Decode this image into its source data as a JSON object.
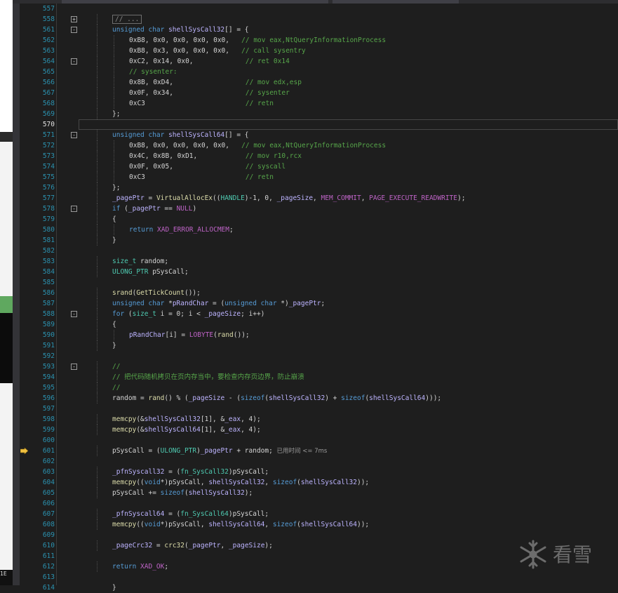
{
  "editor": {
    "first_line": 557,
    "current_line": 570,
    "breakpoint_line": 601,
    "lines": [
      {
        "n": 557,
        "indent": 0,
        "segs": []
      },
      {
        "n": 558,
        "fold": "+",
        "indent": 1,
        "collapsed": "// ..."
      },
      {
        "n": 561,
        "fold": "-",
        "indent": 1,
        "segs": [
          [
            "k",
            "unsigned char "
          ],
          [
            "v",
            "shellSysCall32"
          ],
          [
            "p",
            "[] = {"
          ]
        ]
      },
      {
        "n": 562,
        "indent": 2,
        "segs": [
          [
            "p",
            "0xB8, 0x0, 0x0, 0x0, 0x0,   "
          ],
          [
            "c",
            "// mov eax,NtQueryInformationProcess"
          ]
        ]
      },
      {
        "n": 563,
        "indent": 2,
        "segs": [
          [
            "p",
            "0xB8, 0x3, 0x0, 0x0, 0x0,   "
          ],
          [
            "c",
            "// call sysentry"
          ]
        ]
      },
      {
        "n": 564,
        "fold": "-",
        "indent": 2,
        "segs": [
          [
            "p",
            "0xC2, 0x14, 0x0,             "
          ],
          [
            "c",
            "// ret 0x14"
          ]
        ]
      },
      {
        "n": 565,
        "indent": 2,
        "segs": [
          [
            "c",
            "// sysenter:"
          ]
        ]
      },
      {
        "n": 566,
        "indent": 2,
        "segs": [
          [
            "p",
            "0x8B, 0xD4,                  "
          ],
          [
            "c",
            "// mov edx,esp"
          ]
        ]
      },
      {
        "n": 567,
        "indent": 2,
        "segs": [
          [
            "p",
            "0x0F, 0x34,                  "
          ],
          [
            "c",
            "// sysenter"
          ]
        ]
      },
      {
        "n": 568,
        "indent": 2,
        "segs": [
          [
            "p",
            "0xC3                         "
          ],
          [
            "c",
            "// retn"
          ]
        ]
      },
      {
        "n": 569,
        "indent": 1,
        "segs": [
          [
            "p",
            "};"
          ]
        ]
      },
      {
        "n": 570,
        "indent": 0,
        "segs": [],
        "current": true
      },
      {
        "n": 571,
        "fold": "-",
        "indent": 1,
        "segs": [
          [
            "k",
            "unsigned char "
          ],
          [
            "v",
            "shellSysCall64"
          ],
          [
            "p",
            "[] = {"
          ]
        ]
      },
      {
        "n": 572,
        "indent": 2,
        "segs": [
          [
            "p",
            "0xB8, 0x0, 0x0, 0x0, 0x0,   "
          ],
          [
            "c",
            "// mov eax,NtQueryInformationProcess"
          ]
        ]
      },
      {
        "n": 573,
        "indent": 2,
        "segs": [
          [
            "p",
            "0x4C, 0x8B, 0xD1,            "
          ],
          [
            "c",
            "// mov r10,rcx"
          ]
        ]
      },
      {
        "n": 574,
        "indent": 2,
        "segs": [
          [
            "p",
            "0x0F, 0x05,                  "
          ],
          [
            "c",
            "// syscall"
          ]
        ]
      },
      {
        "n": 575,
        "indent": 2,
        "segs": [
          [
            "p",
            "0xC3                         "
          ],
          [
            "c",
            "// retn"
          ]
        ]
      },
      {
        "n": 576,
        "indent": 1,
        "segs": [
          [
            "p",
            "};"
          ]
        ]
      },
      {
        "n": 577,
        "indent": 1,
        "segs": [
          [
            "v",
            "_pagePtr"
          ],
          [
            "p",
            " = "
          ],
          [
            "f",
            "VirtualAllocEx"
          ],
          [
            "p",
            "(("
          ],
          [
            "t",
            "HANDLE"
          ],
          [
            "p",
            ")-1, 0, "
          ],
          [
            "v",
            "_pageSize"
          ],
          [
            "p",
            ", "
          ],
          [
            "m",
            "MEM_COMMIT"
          ],
          [
            "p",
            ", "
          ],
          [
            "m",
            "PAGE_EXECUTE_READWRITE"
          ],
          [
            "p",
            ");"
          ]
        ]
      },
      {
        "n": 578,
        "fold": "-",
        "indent": 1,
        "segs": [
          [
            "k",
            "if"
          ],
          [
            "p",
            " ("
          ],
          [
            "v",
            "_pagePtr"
          ],
          [
            "p",
            " == "
          ],
          [
            "m",
            "NULL"
          ],
          [
            "p",
            ")"
          ]
        ]
      },
      {
        "n": 579,
        "indent": 1,
        "segs": [
          [
            "p",
            "{"
          ]
        ]
      },
      {
        "n": 580,
        "indent": 2,
        "segs": [
          [
            "k",
            "return "
          ],
          [
            "m",
            "XAD_ERROR_ALLOCMEM"
          ],
          [
            "p",
            ";"
          ]
        ]
      },
      {
        "n": 581,
        "indent": 1,
        "segs": [
          [
            "p",
            "}"
          ]
        ]
      },
      {
        "n": 582,
        "indent": 0,
        "segs": []
      },
      {
        "n": 583,
        "indent": 1,
        "segs": [
          [
            "t",
            "size_t"
          ],
          [
            "p",
            " random;"
          ]
        ]
      },
      {
        "n": 584,
        "indent": 1,
        "segs": [
          [
            "t",
            "ULONG_PTR"
          ],
          [
            "p",
            " pSysCall;"
          ]
        ]
      },
      {
        "n": 585,
        "indent": 0,
        "segs": []
      },
      {
        "n": 586,
        "indent": 1,
        "segs": [
          [
            "f",
            "srand"
          ],
          [
            "p",
            "("
          ],
          [
            "f",
            "GetTickCount"
          ],
          [
            "p",
            "());"
          ]
        ]
      },
      {
        "n": 587,
        "indent": 1,
        "segs": [
          [
            "k",
            "unsigned char "
          ],
          [
            "p",
            "*"
          ],
          [
            "v",
            "pRandChar"
          ],
          [
            "p",
            " = ("
          ],
          [
            "k",
            "unsigned char "
          ],
          [
            "p",
            "*)"
          ],
          [
            "v",
            "_pagePtr"
          ],
          [
            "p",
            ";"
          ]
        ]
      },
      {
        "n": 588,
        "fold": "-",
        "indent": 1,
        "segs": [
          [
            "k",
            "for"
          ],
          [
            "p",
            " ("
          ],
          [
            "t",
            "size_t"
          ],
          [
            "p",
            " i = 0; i < "
          ],
          [
            "v",
            "_pageSize"
          ],
          [
            "p",
            "; i++)"
          ]
        ]
      },
      {
        "n": 589,
        "indent": 1,
        "segs": [
          [
            "p",
            "{"
          ]
        ]
      },
      {
        "n": 590,
        "indent": 2,
        "segs": [
          [
            "v",
            "pRandChar"
          ],
          [
            "p",
            "[i] = "
          ],
          [
            "m",
            "LOBYTE"
          ],
          [
            "p",
            "("
          ],
          [
            "f",
            "rand"
          ],
          [
            "p",
            "());"
          ]
        ]
      },
      {
        "n": 591,
        "indent": 1,
        "segs": [
          [
            "p",
            "}"
          ]
        ]
      },
      {
        "n": 592,
        "indent": 0,
        "segs": []
      },
      {
        "n": 593,
        "fold": "-",
        "indent": 1,
        "segs": [
          [
            "c",
            "//"
          ]
        ]
      },
      {
        "n": 594,
        "indent": 1,
        "segs": [
          [
            "c",
            "// 把代码随机拷贝在页内存当中，要检查内存页边界，防止崩溃"
          ]
        ]
      },
      {
        "n": 595,
        "indent": 1,
        "segs": [
          [
            "c",
            "//"
          ]
        ]
      },
      {
        "n": 596,
        "indent": 1,
        "segs": [
          [
            "p",
            "random = "
          ],
          [
            "f",
            "rand"
          ],
          [
            "p",
            "() % ("
          ],
          [
            "v",
            "_pageSize"
          ],
          [
            "p",
            " - ("
          ],
          [
            "k",
            "sizeof"
          ],
          [
            "p",
            "("
          ],
          [
            "v",
            "shellSysCall32"
          ],
          [
            "p",
            ") + "
          ],
          [
            "k",
            "sizeof"
          ],
          [
            "p",
            "("
          ],
          [
            "v",
            "shellSysCall64"
          ],
          [
            "p",
            ")));"
          ]
        ]
      },
      {
        "n": 597,
        "indent": 0,
        "segs": []
      },
      {
        "n": 598,
        "indent": 1,
        "segs": [
          [
            "f",
            "memcpy"
          ],
          [
            "p",
            "(&"
          ],
          [
            "v",
            "shellSysCall32"
          ],
          [
            "p",
            "[1], &"
          ],
          [
            "v",
            "_eax"
          ],
          [
            "p",
            ", 4);"
          ]
        ]
      },
      {
        "n": 599,
        "indent": 1,
        "segs": [
          [
            "f",
            "memcpy"
          ],
          [
            "p",
            "(&"
          ],
          [
            "v",
            "shellSysCall64"
          ],
          [
            "p",
            "[1], &"
          ],
          [
            "v",
            "_eax"
          ],
          [
            "p",
            ", 4);"
          ]
        ]
      },
      {
        "n": 600,
        "indent": 0,
        "segs": []
      },
      {
        "n": 601,
        "indent": 1,
        "segs": [
          [
            "p",
            "pSysCall = ("
          ],
          [
            "t",
            "ULONG_PTR"
          ],
          [
            "p",
            ")"
          ],
          [
            "v",
            "_pagePtr"
          ],
          [
            "p",
            " + random; "
          ]
        ],
        "hint": "已用时间 <= 7ms"
      },
      {
        "n": 602,
        "indent": 0,
        "segs": []
      },
      {
        "n": 603,
        "indent": 1,
        "segs": [
          [
            "v",
            "_pfnSyscall32"
          ],
          [
            "p",
            " = ("
          ],
          [
            "t",
            "fn_SysCall32"
          ],
          [
            "p",
            ")pSysCall;"
          ]
        ]
      },
      {
        "n": 604,
        "indent": 1,
        "segs": [
          [
            "f",
            "memcpy"
          ],
          [
            "p",
            "(("
          ],
          [
            "k",
            "void"
          ],
          [
            "p",
            "*)pSysCall, "
          ],
          [
            "v",
            "shellSysCall32"
          ],
          [
            "p",
            ", "
          ],
          [
            "k",
            "sizeof"
          ],
          [
            "p",
            "("
          ],
          [
            "v",
            "shellSysCall32"
          ],
          [
            "p",
            "));"
          ]
        ]
      },
      {
        "n": 605,
        "indent": 1,
        "segs": [
          [
            "p",
            "pSysCall += "
          ],
          [
            "k",
            "sizeof"
          ],
          [
            "p",
            "("
          ],
          [
            "v",
            "shellSysCall32"
          ],
          [
            "p",
            ");"
          ]
        ]
      },
      {
        "n": 606,
        "indent": 0,
        "segs": []
      },
      {
        "n": 607,
        "indent": 1,
        "segs": [
          [
            "v",
            "_pfnSyscall64"
          ],
          [
            "p",
            " = ("
          ],
          [
            "t",
            "fn_SysCall64"
          ],
          [
            "p",
            ")pSysCall;"
          ]
        ]
      },
      {
        "n": 608,
        "indent": 1,
        "segs": [
          [
            "f",
            "memcpy"
          ],
          [
            "p",
            "(("
          ],
          [
            "k",
            "void"
          ],
          [
            "p",
            "*)pSysCall, "
          ],
          [
            "v",
            "shellSysCall64"
          ],
          [
            "p",
            ", "
          ],
          [
            "k",
            "sizeof"
          ],
          [
            "p",
            "("
          ],
          [
            "v",
            "shellSysCall64"
          ],
          [
            "p",
            "));"
          ]
        ]
      },
      {
        "n": 609,
        "indent": 0,
        "segs": []
      },
      {
        "n": 610,
        "indent": 1,
        "segs": [
          [
            "v",
            "_pageCrc32"
          ],
          [
            "p",
            " = "
          ],
          [
            "f",
            "crc32"
          ],
          [
            "p",
            "("
          ],
          [
            "v",
            "_pagePtr"
          ],
          [
            "p",
            ", "
          ],
          [
            "v",
            "_pageSize"
          ],
          [
            "p",
            ");"
          ]
        ]
      },
      {
        "n": 611,
        "indent": 0,
        "segs": []
      },
      {
        "n": 612,
        "indent": 1,
        "segs": [
          [
            "k",
            "return "
          ],
          [
            "m",
            "XAD_OK"
          ],
          [
            "p",
            ";"
          ]
        ]
      },
      {
        "n": 613,
        "indent": 0,
        "segs": []
      },
      {
        "n": 614,
        "indent": 0,
        "segs": [
          [
            "p",
            "}"
          ]
        ]
      }
    ]
  },
  "watermark": {
    "text": "看雪",
    "icon": "snowflake-icon"
  },
  "left_strip_text": "1E"
}
